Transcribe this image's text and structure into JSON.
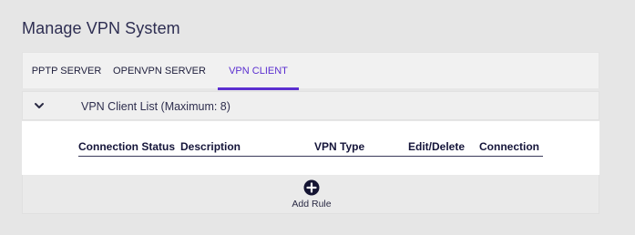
{
  "page": {
    "title": "Manage VPN System"
  },
  "tabs": [
    {
      "label": "PPTP SERVER"
    },
    {
      "label": "OPENVPN SERVER"
    },
    {
      "label": "VPN CLIENT",
      "active": true
    }
  ],
  "section": {
    "title": "VPN Client List (Maximum: 8)",
    "expanded": true,
    "chevron_icon": "chevron-down-icon"
  },
  "table": {
    "columns": [
      "Connection Status",
      "Description",
      "VPN Type",
      "Edit/Delete",
      "Connection"
    ],
    "rows": []
  },
  "add_rule": {
    "label": "Add Rule",
    "icon": "plus-circle-icon"
  },
  "colors": {
    "accent": "#5b2fd0",
    "text": "#1a1a3a",
    "background": "#e6e6e6"
  }
}
